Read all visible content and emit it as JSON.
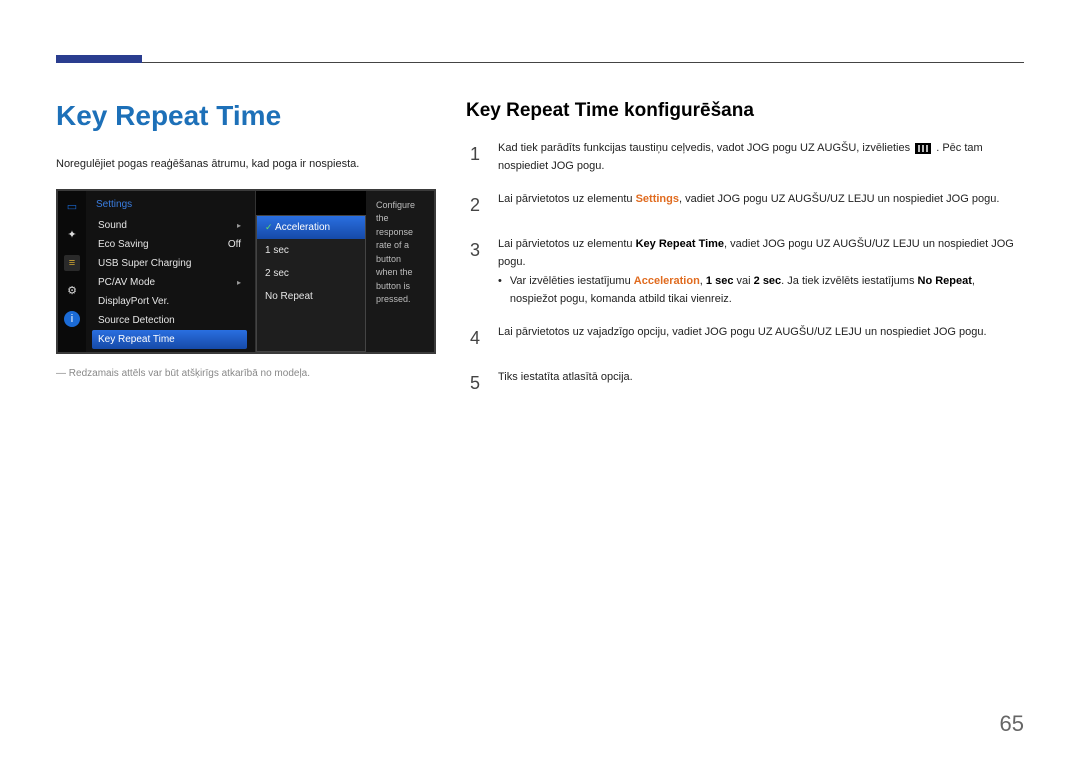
{
  "header_title": "Key Repeat Time",
  "left": {
    "description": "Noregulējiet pogas reaģēšanas ātrumu, kad poga ir nospiesta.",
    "footnote": "Redzamais attēls var būt atšķirīgs atkarībā no modeļa."
  },
  "osd": {
    "title": "Settings",
    "items": [
      {
        "label": "Sound",
        "value": "",
        "arrow": true
      },
      {
        "label": "Eco Saving",
        "value": "Off"
      },
      {
        "label": "USB Super Charging",
        "value": ""
      },
      {
        "label": "PC/AV Mode",
        "value": "",
        "arrow": true
      },
      {
        "label": "DisplayPort Ver.",
        "value": ""
      },
      {
        "label": "Source Detection",
        "value": ""
      },
      {
        "label": "Key Repeat Time",
        "value": "",
        "active": true
      }
    ],
    "submenu": [
      "Acceleration",
      "1 sec",
      "2 sec",
      "No Repeat"
    ],
    "submenu_selected": "Acceleration",
    "help": "Configure the response rate of a button when the button is pressed."
  },
  "right": {
    "heading": "Key Repeat Time konfigurēšana",
    "steps": {
      "s1_a": "Kad tiek parādīts funkcijas taustiņu ceļvedis, vadot JOG pogu UZ AUGŠU, izvēlieties",
      "s1_b": ". Pēc tam nospiediet JOG pogu.",
      "s2_a": "Lai pārvietotos uz elementu ",
      "s2_kw": "Settings",
      "s2_b": ", vadiet JOG pogu UZ AUGŠU/UZ LEJU un nospiediet JOG pogu.",
      "s3_a": "Lai pārvietotos uz elementu ",
      "s3_kw": "Key Repeat Time",
      "s3_b": ", vadiet JOG pogu UZ AUGŠU/UZ LEJU un nospiediet JOG pogu.",
      "s3_bullet_a": "Var izvēlēties iestatījumu ",
      "s3_kw_acc": "Acceleration",
      "s3_sep1": ", ",
      "s3_kw_1s": "1 sec",
      "s3_sep2": " vai ",
      "s3_kw_2s": "2 sec",
      "s3_bullet_b": ". Ja tiek izvēlēts iestatījums ",
      "s3_kw_nr": "No Repeat",
      "s3_bullet_c": ", nospiežot pogu, komanda atbild tikai vienreiz.",
      "s4": "Lai pārvietotos uz vajadzīgo opciju, vadiet JOG pogu UZ AUGŠU/UZ LEJU un nospiediet JOG pogu.",
      "s5": "Tiks iestatīta atlasītā opcija."
    }
  },
  "page_number": "65"
}
